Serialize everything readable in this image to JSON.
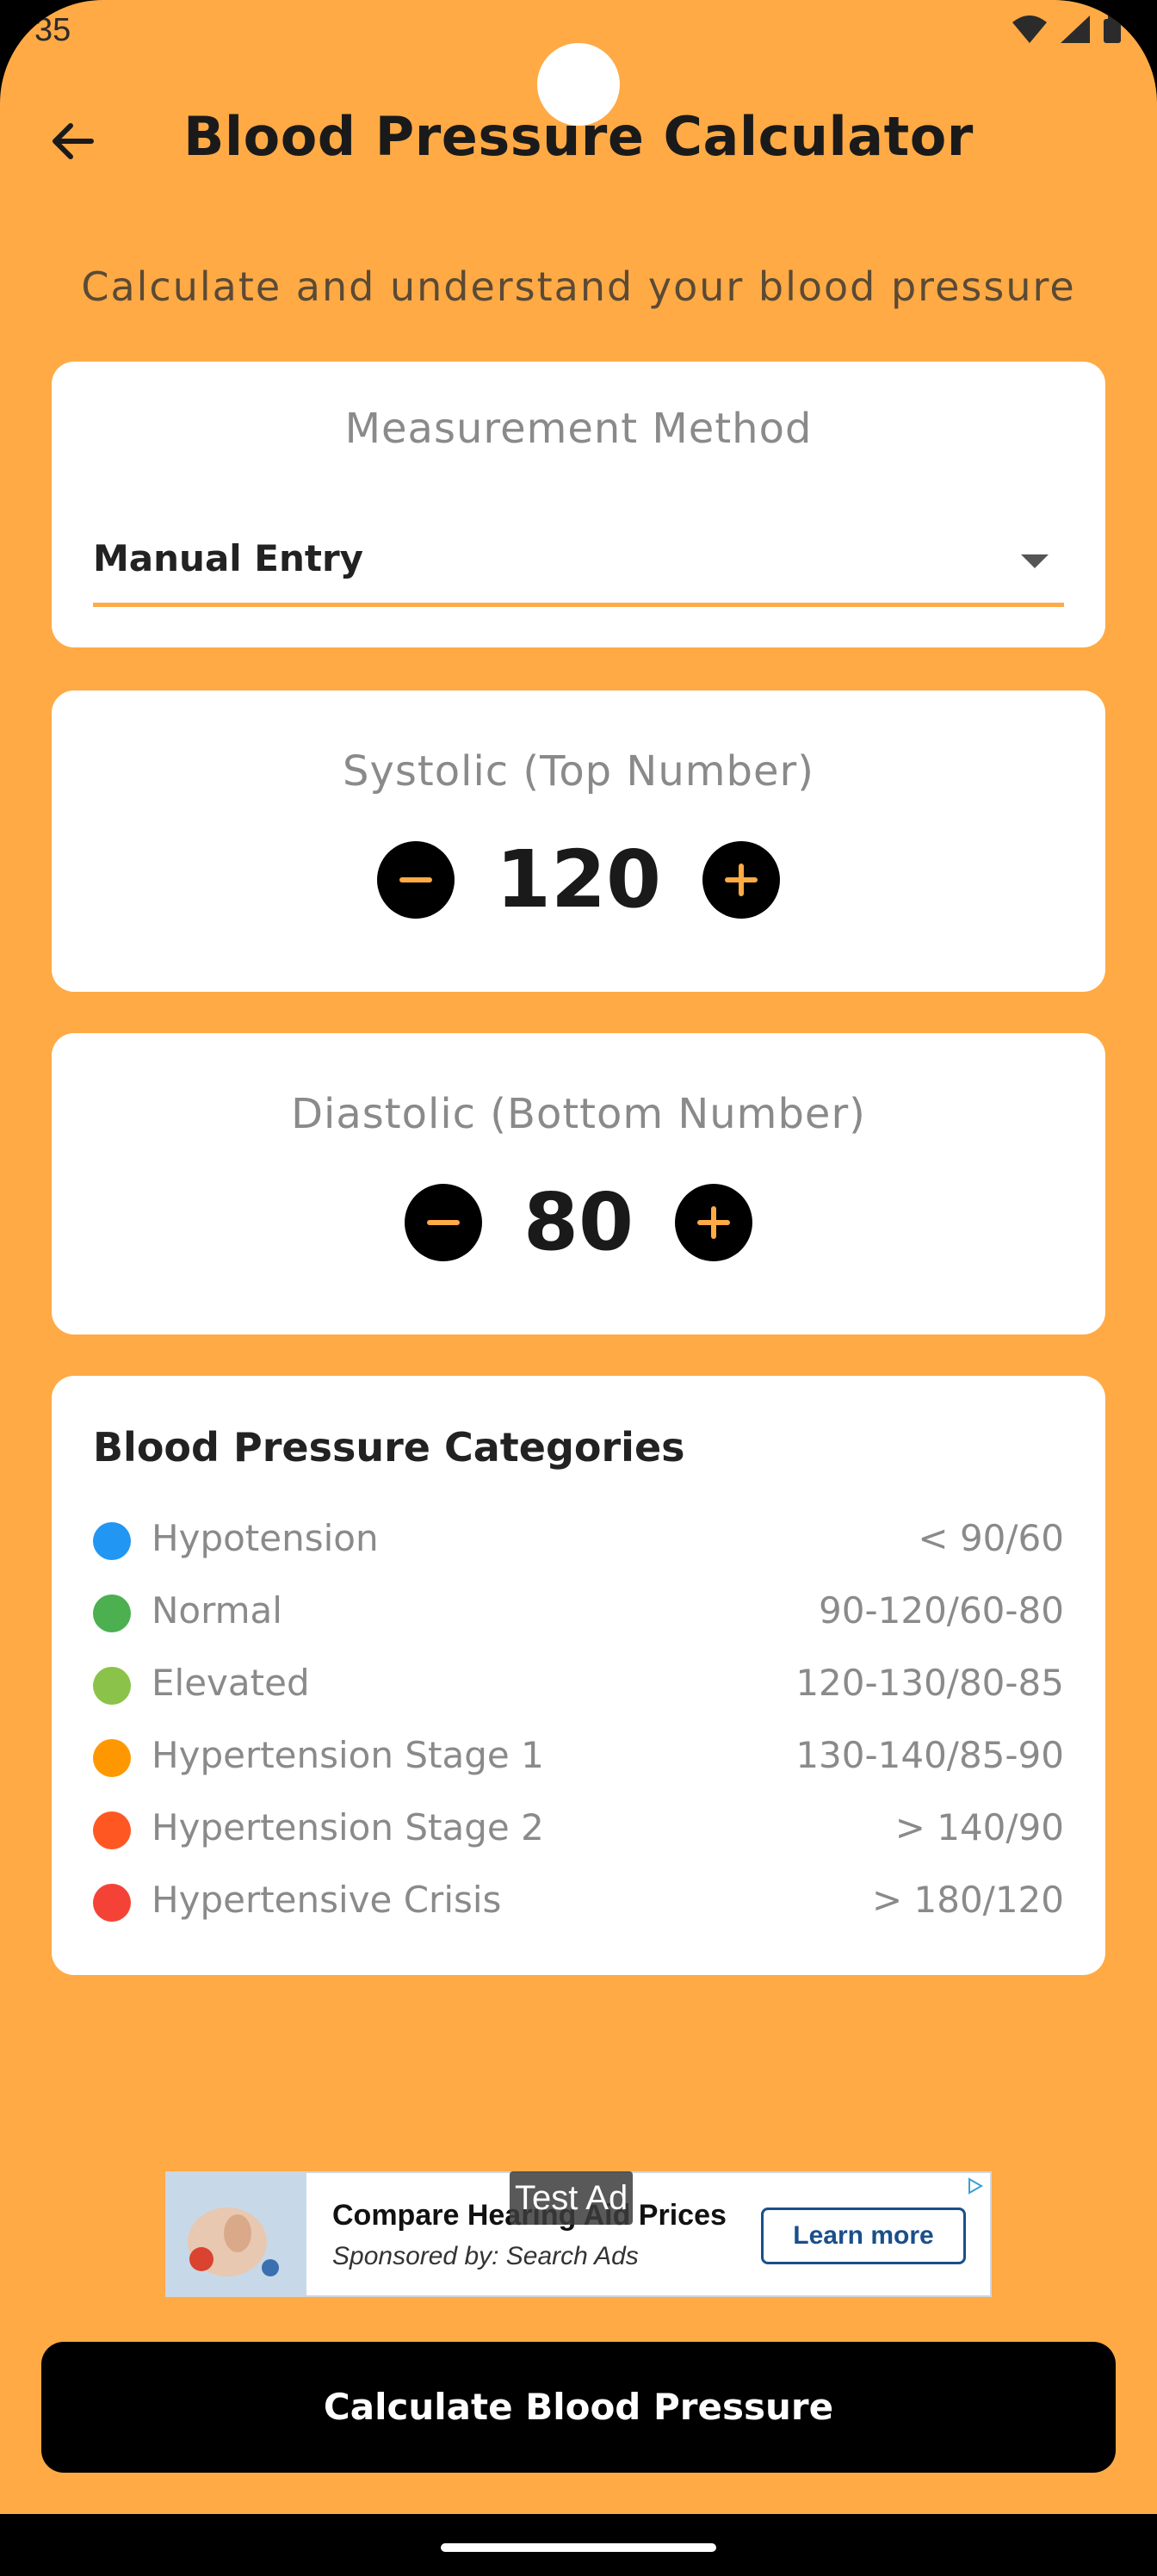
{
  "status": {
    "time": "35"
  },
  "header": {
    "title": "Blood Pressure Calculator"
  },
  "subtitle": "Calculate and understand your blood pressure",
  "method": {
    "label": "Measurement Method",
    "value": "Manual Entry"
  },
  "systolic": {
    "label": "Systolic (Top Number)",
    "value": "120"
  },
  "diastolic": {
    "label": "Diastolic (Bottom Number)",
    "value": "80"
  },
  "categories": {
    "title": "Blood Pressure Categories",
    "items": [
      {
        "name": "Hypotension",
        "range": "< 90/60",
        "color": "#2196F3"
      },
      {
        "name": "Normal",
        "range": "90-120/60-80",
        "color": "#4CAF50"
      },
      {
        "name": "Elevated",
        "range": "120-130/80-85",
        "color": "#8BC34A"
      },
      {
        "name": "Hypertension Stage 1",
        "range": "130-140/85-90",
        "color": "#FF9800"
      },
      {
        "name": "Hypertension Stage 2",
        "range": "> 140/90",
        "color": "#FF5722"
      },
      {
        "name": "Hypertensive Crisis",
        "range": "> 180/120",
        "color": "#F44336"
      }
    ]
  },
  "ad": {
    "badge": "Test Ad",
    "title": "Compare Hearing Aid Prices",
    "sponsor": "Sponsored by: Search Ads",
    "cta": "Learn more"
  },
  "calculate_button": "Calculate Blood Pressure",
  "colors": {
    "accent": "#FFAA45",
    "background": "#FFAA45"
  }
}
